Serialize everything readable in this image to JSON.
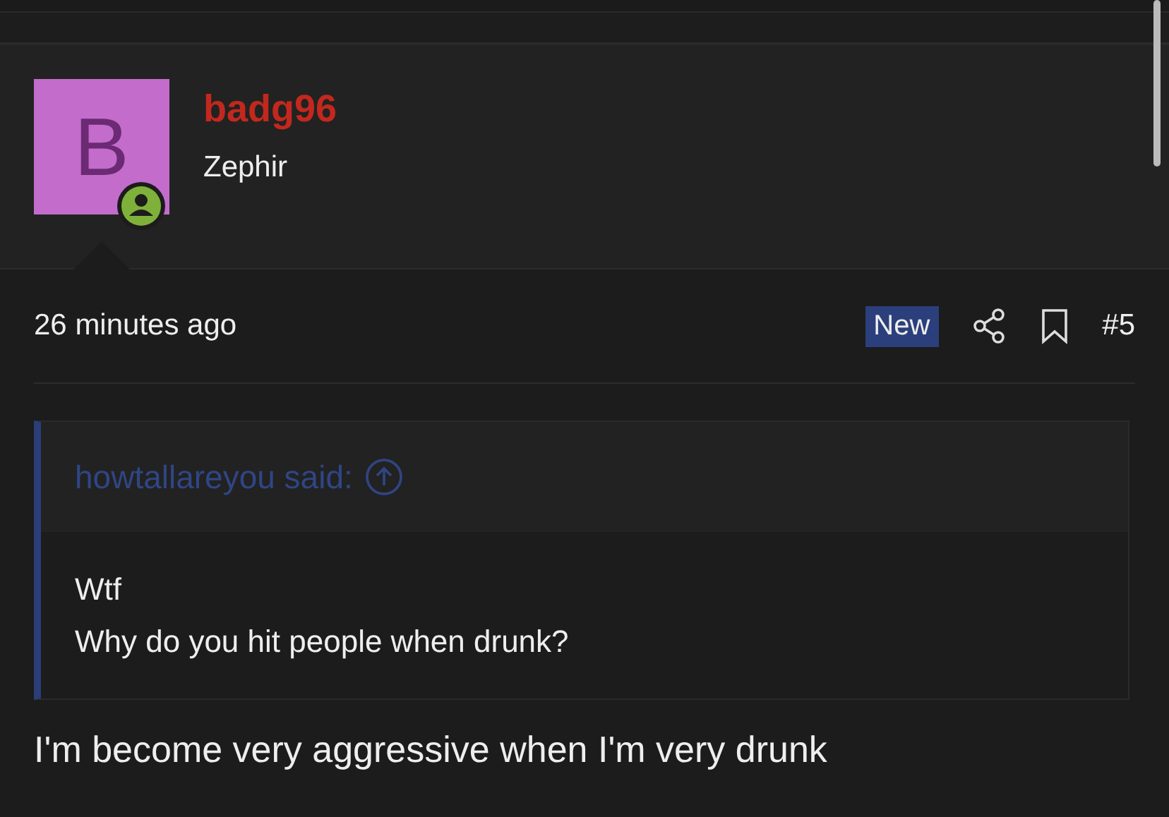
{
  "user": {
    "avatar_letter": "B",
    "name": "badg96",
    "title": "Zephir",
    "online": true
  },
  "post": {
    "time": "26 minutes ago",
    "badge": "New",
    "number": "#5"
  },
  "quote": {
    "attribution": "howtallareyou said:",
    "lines": [
      "Wtf",
      "Why do you hit people when drunk?"
    ]
  },
  "body": "I'm become very aggressive when I'm very drunk"
}
